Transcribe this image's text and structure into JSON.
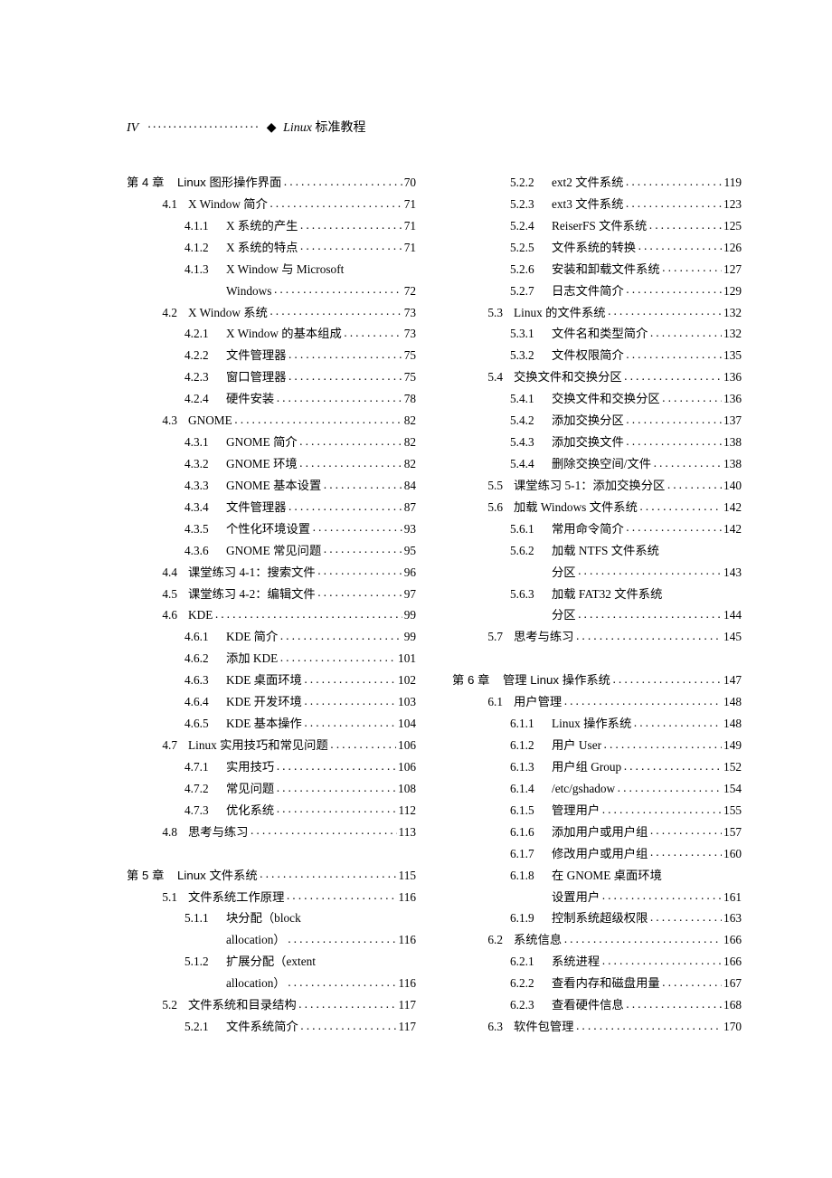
{
  "header": {
    "page_numeral": "IV",
    "dots": "······················",
    "diamond": "◆",
    "book_title_en": "Linux",
    "book_title_cn": " 标准教程"
  },
  "left": [
    {
      "level": 0,
      "num": "第 4 章",
      "title": "Linux 图形操作界面",
      "page": "70"
    },
    {
      "level": 1,
      "num": "4.1",
      "title": "X Window 简介",
      "page": "71"
    },
    {
      "level": 2,
      "num": "4.1.1",
      "title": "X 系统的产生",
      "page": "71"
    },
    {
      "level": 2,
      "num": "4.1.2",
      "title": "X 系统的特点",
      "page": "71"
    },
    {
      "level": 2,
      "num": "4.1.3",
      "title": "X Window 与 Microsoft",
      "cont": "Windows",
      "page": "72"
    },
    {
      "level": 1,
      "num": "4.2",
      "title": "X Window 系统",
      "page": "73"
    },
    {
      "level": 2,
      "num": "4.2.1",
      "title": "X Window 的基本组成",
      "page": "73"
    },
    {
      "level": 2,
      "num": "4.2.2",
      "title": "文件管理器",
      "page": "75"
    },
    {
      "level": 2,
      "num": "4.2.3",
      "title": "窗口管理器",
      "page": "75"
    },
    {
      "level": 2,
      "num": "4.2.4",
      "title": "硬件安装",
      "page": "78"
    },
    {
      "level": 1,
      "num": "4.3",
      "title": "GNOME",
      "page": "82"
    },
    {
      "level": 2,
      "num": "4.3.1",
      "title": "GNOME 简介",
      "page": "82"
    },
    {
      "level": 2,
      "num": "4.3.2",
      "title": "GNOME 环境",
      "page": "82"
    },
    {
      "level": 2,
      "num": "4.3.3",
      "title": "GNOME 基本设置",
      "page": "84"
    },
    {
      "level": 2,
      "num": "4.3.4",
      "title": "文件管理器",
      "page": "87"
    },
    {
      "level": 2,
      "num": "4.3.5",
      "title": "个性化环境设置",
      "page": "93"
    },
    {
      "level": 2,
      "num": "4.3.6",
      "title": "GNOME 常见问题",
      "page": "95"
    },
    {
      "level": 1,
      "num": "4.4",
      "title": "课堂练习 4-1：搜索文件",
      "page": "96"
    },
    {
      "level": 1,
      "num": "4.5",
      "title": "课堂练习 4-2：编辑文件",
      "page": "97"
    },
    {
      "level": 1,
      "num": "4.6",
      "title": "KDE",
      "page": "99"
    },
    {
      "level": 2,
      "num": "4.6.1",
      "title": "KDE 简介",
      "page": "99"
    },
    {
      "level": 2,
      "num": "4.6.2",
      "title": "添加 KDE",
      "page": "101"
    },
    {
      "level": 2,
      "num": "4.6.3",
      "title": "KDE 桌面环境",
      "page": "102"
    },
    {
      "level": 2,
      "num": "4.6.4",
      "title": "KDE 开发环境",
      "page": "103"
    },
    {
      "level": 2,
      "num": "4.6.5",
      "title": "KDE 基本操作",
      "page": "104"
    },
    {
      "level": 1,
      "num": "4.7",
      "title": "Linux 实用技巧和常见问题",
      "page": "106"
    },
    {
      "level": 2,
      "num": "4.7.1",
      "title": "实用技巧",
      "page": "106"
    },
    {
      "level": 2,
      "num": "4.7.2",
      "title": "常见问题",
      "page": "108"
    },
    {
      "level": 2,
      "num": "4.7.3",
      "title": "优化系统",
      "page": "112"
    },
    {
      "level": 1,
      "num": "4.8",
      "title": "思考与练习",
      "page": "113"
    },
    {
      "spacer": true
    },
    {
      "level": 0,
      "num": "第 5 章",
      "title": "Linux 文件系统",
      "page": "115"
    },
    {
      "level": 1,
      "num": "5.1",
      "title": "文件系统工作原理",
      "page": "116"
    },
    {
      "level": 2,
      "num": "5.1.1",
      "title": "块分配（block",
      "cont": "allocation）",
      "page": "116"
    },
    {
      "level": 2,
      "num": "5.1.2",
      "title": "扩展分配（extent",
      "cont": "allocation）",
      "page": "116"
    },
    {
      "level": 1,
      "num": "5.2",
      "title": "文件系统和目录结构",
      "page": "117"
    },
    {
      "level": 2,
      "num": "5.2.1",
      "title": "文件系统简介",
      "page": "117"
    }
  ],
  "right": [
    {
      "level": 2,
      "num": "5.2.2",
      "title": "ext2 文件系统",
      "page": "119"
    },
    {
      "level": 2,
      "num": "5.2.3",
      "title": "ext3 文件系统",
      "page": "123"
    },
    {
      "level": 2,
      "num": "5.2.4",
      "title": "ReiserFS 文件系统",
      "page": "125"
    },
    {
      "level": 2,
      "num": "5.2.5",
      "title": "文件系统的转换",
      "page": "126"
    },
    {
      "level": 2,
      "num": "5.2.6",
      "title": "安装和卸载文件系统",
      "page": "127"
    },
    {
      "level": 2,
      "num": "5.2.7",
      "title": "日志文件简介",
      "page": "129"
    },
    {
      "level": 1,
      "num": "5.3",
      "title": "Linux 的文件系统",
      "page": "132"
    },
    {
      "level": 2,
      "num": "5.3.1",
      "title": "文件名和类型简介",
      "page": "132"
    },
    {
      "level": 2,
      "num": "5.3.2",
      "title": "文件权限简介",
      "page": "135"
    },
    {
      "level": 1,
      "num": "5.4",
      "title": "交换文件和交换分区",
      "page": "136"
    },
    {
      "level": 2,
      "num": "5.4.1",
      "title": "交换文件和交换分区",
      "page": "136"
    },
    {
      "level": 2,
      "num": "5.4.2",
      "title": "添加交换分区",
      "page": "137"
    },
    {
      "level": 2,
      "num": "5.4.3",
      "title": "添加交换文件",
      "page": "138"
    },
    {
      "level": 2,
      "num": "5.4.4",
      "title": "删除交换空间/文件",
      "page": "138"
    },
    {
      "level": 1,
      "num": "5.5",
      "title": "课堂练习 5-1：添加交换分区",
      "page": "140"
    },
    {
      "level": 1,
      "num": "5.6",
      "title": "加载 Windows 文件系统",
      "page": "142"
    },
    {
      "level": 2,
      "num": "5.6.1",
      "title": "常用命令简介",
      "page": "142"
    },
    {
      "level": 2,
      "num": "5.6.2",
      "title": "加载 NTFS 文件系统",
      "cont": "分区",
      "page": "143"
    },
    {
      "level": 2,
      "num": "5.6.3",
      "title": "加载 FAT32 文件系统",
      "cont": "分区",
      "page": "144"
    },
    {
      "level": 1,
      "num": "5.7",
      "title": "思考与练习",
      "page": "145"
    },
    {
      "spacer": true
    },
    {
      "level": 0,
      "num": "第 6 章",
      "title": "管理 Linux 操作系统",
      "page": "147"
    },
    {
      "level": 1,
      "num": "6.1",
      "title": "用户管理",
      "page": "148"
    },
    {
      "level": 2,
      "num": "6.1.1",
      "title": "Linux 操作系统",
      "page": "148"
    },
    {
      "level": 2,
      "num": "6.1.2",
      "title": "用户 User",
      "page": "149"
    },
    {
      "level": 2,
      "num": "6.1.3",
      "title": "用户组 Group",
      "page": "152"
    },
    {
      "level": 2,
      "num": "6.1.4",
      "title": "/etc/gshadow",
      "page": "154"
    },
    {
      "level": 2,
      "num": "6.1.5",
      "title": "管理用户",
      "page": "155"
    },
    {
      "level": 2,
      "num": "6.1.6",
      "title": "添加用户或用户组",
      "page": "157"
    },
    {
      "level": 2,
      "num": "6.1.7",
      "title": "修改用户或用户组",
      "page": "160"
    },
    {
      "level": 2,
      "num": "6.1.8",
      "title": "在 GNOME 桌面环境",
      "cont": "设置用户",
      "page": "161"
    },
    {
      "level": 2,
      "num": "6.1.9",
      "title": "控制系统超级权限",
      "page": "163"
    },
    {
      "level": 1,
      "num": "6.2",
      "title": "系统信息",
      "page": "166"
    },
    {
      "level": 2,
      "num": "6.2.1",
      "title": "系统进程",
      "page": "166"
    },
    {
      "level": 2,
      "num": "6.2.2",
      "title": "查看内存和磁盘用量",
      "page": "167"
    },
    {
      "level": 2,
      "num": "6.2.3",
      "title": "查看硬件信息",
      "page": "168"
    },
    {
      "level": 1,
      "num": "6.3",
      "title": "软件包管理",
      "page": "170"
    }
  ]
}
